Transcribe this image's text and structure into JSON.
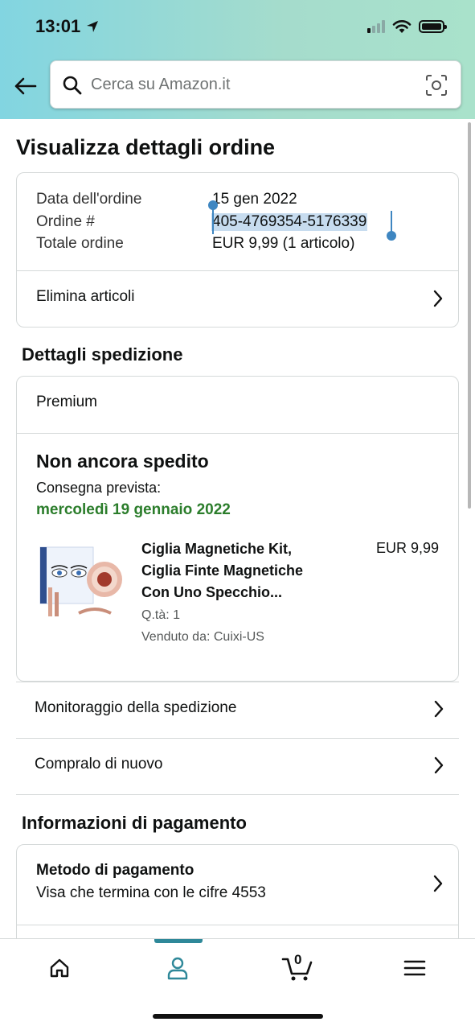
{
  "status_bar": {
    "time": "13:01",
    "colors": {
      "accent": "#2e8899",
      "link": "#3e86c1",
      "success": "#2b7d2b"
    }
  },
  "search": {
    "placeholder": "Cerca su Amazon.it"
  },
  "page_title": "Visualizza dettagli ordine",
  "order_summary": {
    "date_label": "Data dell'ordine",
    "date_value": "15 gen 2022",
    "number_label": "Ordine #",
    "number_value": "405-4769354-5176339",
    "total_label": "Totale ordine",
    "total_value": "EUR 9,99 (1 articolo)",
    "delete_items_label": "Elimina articoli"
  },
  "shipping": {
    "heading": "Dettagli spedizione",
    "method": "Premium",
    "status": "Non ancora spedito",
    "delivery_label": "Consegna prevista:",
    "delivery_date": "mercoledì 19 gennaio 2022",
    "item": {
      "title_line1": "Ciglia Magnetiche Kit,",
      "title_line2": "Ciglia Finte Magnetiche",
      "title_line3": "Con Uno Specchio...",
      "price": "EUR 9,99",
      "quantity": "Q.tà: 1",
      "seller": "Venduto da: Cuixi-US",
      "image_icon": "product-thumbnail"
    },
    "track_label": "Monitoraggio della spedizione",
    "buy_again_label": "Compralo di nuovo"
  },
  "payment": {
    "heading": "Informazioni di pagamento",
    "method_label": "Metodo di pagamento",
    "method_value": "Visa che termina con le cifre 4553"
  },
  "tabbar": {
    "items": [
      {
        "icon": "home-icon"
      },
      {
        "icon": "user-icon",
        "active": true
      },
      {
        "icon": "cart-icon",
        "badge": "0"
      },
      {
        "icon": "menu-icon"
      }
    ]
  }
}
